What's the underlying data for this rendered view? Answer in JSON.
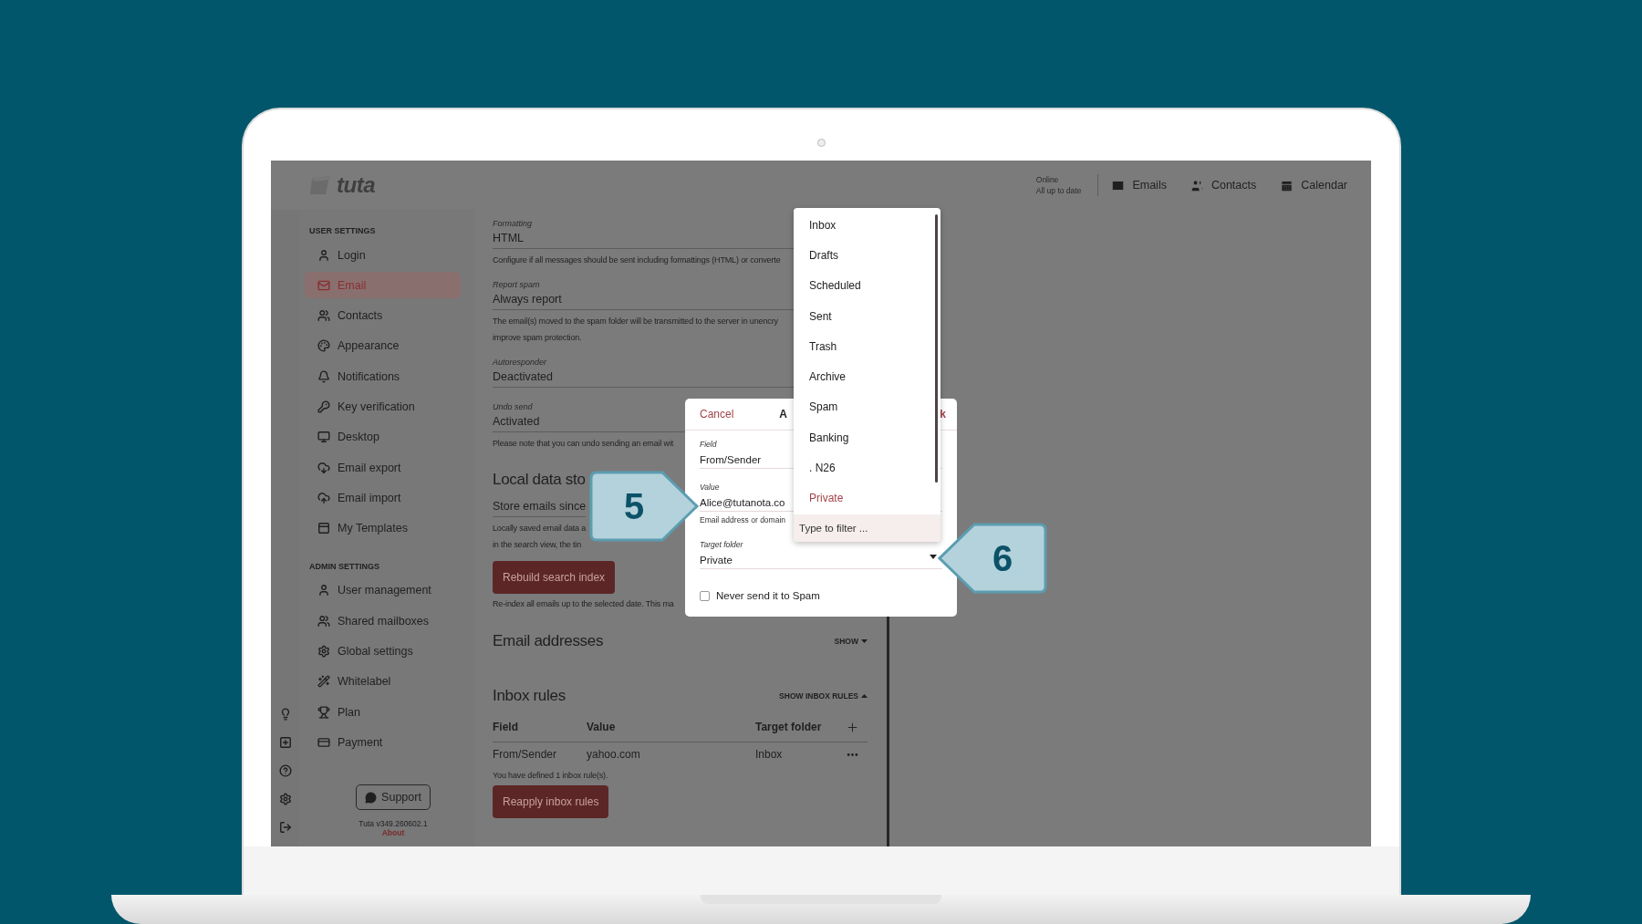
{
  "header": {
    "logo": "tuta",
    "status": [
      "Online",
      "All up to date"
    ],
    "nav": [
      {
        "label": "Emails"
      },
      {
        "label": "Contacts"
      },
      {
        "label": "Calendar"
      }
    ]
  },
  "sidebar": {
    "sections": [
      {
        "heading": "USER SETTINGS",
        "items": [
          {
            "label": "Login",
            "selected": false
          },
          {
            "label": "Email",
            "selected": true
          },
          {
            "label": "Contacts",
            "selected": false
          },
          {
            "label": "Appearance",
            "selected": false
          },
          {
            "label": "Notifications",
            "selected": false
          },
          {
            "label": "Key verification",
            "selected": false
          },
          {
            "label": "Desktop",
            "selected": false
          },
          {
            "label": "Email export",
            "selected": false
          },
          {
            "label": "Email import",
            "selected": false
          },
          {
            "label": "My Templates",
            "selected": false
          }
        ]
      },
      {
        "heading": "ADMIN SETTINGS",
        "items": [
          {
            "label": "User management",
            "selected": false
          },
          {
            "label": "Shared mailboxes",
            "selected": false
          },
          {
            "label": "Global settings",
            "selected": false
          },
          {
            "label": "Whitelabel",
            "selected": false
          },
          {
            "label": "Plan",
            "selected": false
          },
          {
            "label": "Payment",
            "selected": false
          }
        ]
      }
    ],
    "support": "Support",
    "version": "Tuta v349.260602.1",
    "about": "About"
  },
  "settings": [
    {
      "label": "Formatting",
      "value": "HTML",
      "help": [
        "Configure if all messages should be sent including formattings (HTML) or converte"
      ]
    },
    {
      "label": "Report spam",
      "value": "Always report",
      "help": [
        "The email(s) moved to the spam folder will be transmitted to the server in unencry",
        "improve spam protection."
      ]
    },
    {
      "label": "Autoresponder",
      "value": "Deactivated"
    },
    {
      "label": "Undo send",
      "value": "Activated",
      "help": [
        "Please note that you can undo sending an email wit"
      ]
    }
  ],
  "local_data": {
    "title": "Local data sto",
    "field": "Store emails since",
    "help": [
      "Locally saved email data a",
      "in the search view, the tin"
    ],
    "button": "Rebuild search index",
    "note": "Re-index all emails up to the selected date. This ma"
  },
  "email_addresses": {
    "title": "Email addresses",
    "toggle": "SHOW",
    "expanded": false
  },
  "inbox_rules": {
    "title": "Inbox rules",
    "toggle": "SHOW INBOX RULES",
    "expanded": true,
    "columns": [
      "Field",
      "Value",
      "Target folder"
    ],
    "rows": [
      {
        "field": "From/Sender",
        "value": "yahoo.com",
        "target_folder": "Inbox"
      }
    ],
    "summary": "You have defined 1 inbox rule(s).",
    "button": "Reapply inbox rules"
  },
  "dialog": {
    "cancel": "Cancel",
    "title": "A",
    "ok": "k",
    "fields": [
      {
        "label": "Field",
        "value": "From/Sender"
      },
      {
        "label": "Value",
        "value": "Alice@tutanota.co",
        "help": "Email address or domain"
      },
      {
        "label": "Target folder",
        "value": "Private"
      }
    ],
    "checkbox": {
      "label": "Never send it to Spam",
      "checked": false
    }
  },
  "dropdown": {
    "items": [
      {
        "label": "Inbox",
        "selected": false
      },
      {
        "label": "Drafts",
        "selected": false
      },
      {
        "label": "Scheduled",
        "selected": false
      },
      {
        "label": "Sent",
        "selected": false
      },
      {
        "label": "Trash",
        "selected": false
      },
      {
        "label": "Archive",
        "selected": false
      },
      {
        "label": "Spam",
        "selected": false
      },
      {
        "label": "Banking",
        "selected": false
      },
      {
        "label": ". N26",
        "selected": false
      },
      {
        "label": "Private",
        "selected": true
      }
    ],
    "filter_placeholder": "Type to filter ..."
  },
  "callouts": [
    {
      "number": "5",
      "kind": "right"
    },
    {
      "number": "6",
      "kind": "left"
    }
  ]
}
